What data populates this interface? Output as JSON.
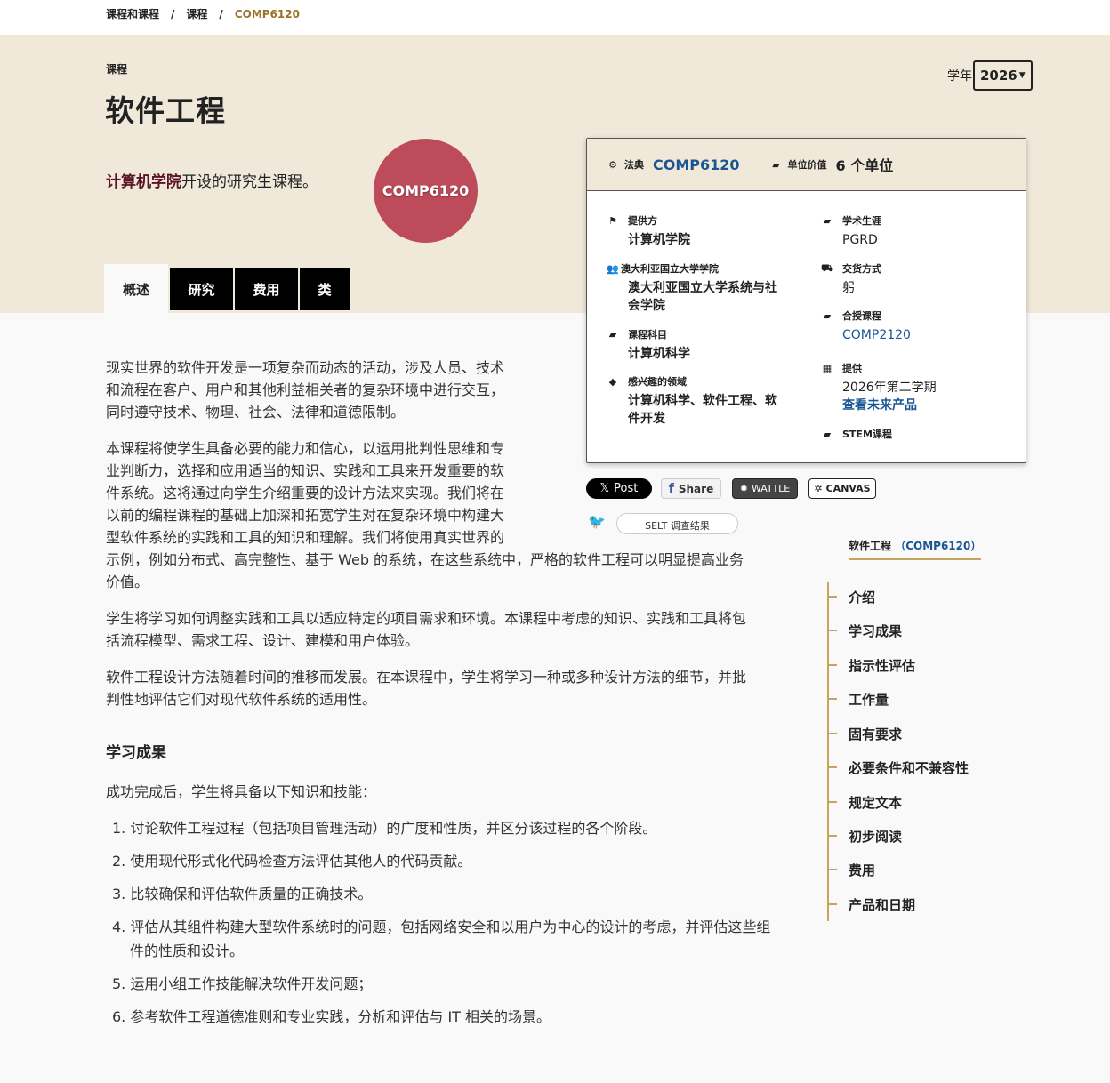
{
  "breadcrumb": [
    "课程和课程",
    "课程",
    "COMP6120"
  ],
  "hero": {
    "eyebrow": "课程",
    "title": "软件工程",
    "intro_school": "计算机学院",
    "intro_rest": "开设的研究生课程。",
    "badge": "COMP6120"
  },
  "year": {
    "label": "学年",
    "value": "2026"
  },
  "tabs": [
    "概述",
    "研究",
    "费用",
    "类"
  ],
  "infobox": {
    "code_label": "法典",
    "code_value": "COMP6120",
    "unit_label": "单位价值",
    "unit_value": "6 个单位",
    "fields": {
      "offered_by_label": "提供方",
      "offered_by_value": "计算机学院",
      "career_label": "学术生涯",
      "career_value": "PGRD",
      "college_label": "澳大利亚国立大学学院",
      "college_value_1": "澳大利亚国立大学系统与社",
      "college_value_2": "会学院",
      "delivery_label": "交货方式",
      "delivery_value": "躬",
      "co_taught_label": "合授课程",
      "co_taught_value": "COMP2120",
      "subject_label": "课程科目",
      "subject_value": "计算机科学",
      "offering_label": "提供",
      "offering_value": "2026年第二学期",
      "offering_link": "查看未来产品",
      "interest_label": "感兴趣的领域",
      "interest_value_1": "计算机科学、软件工程、软",
      "interest_value_2": "件开发",
      "stem_label": "STEM课程"
    }
  },
  "social": {
    "post": "Post",
    "share": "Share",
    "wattle": "WATTLE",
    "canvas": "CANVAS",
    "selt": "SELT 调查结果"
  },
  "body": {
    "p1": [
      "现实世界的软件开发是一项复杂而动态的活动，涉及人员、技术",
      "和流程在客户、用户和其他利益相关者的复杂环境中进行交互，",
      "同时遵守技术、物理、社会、法律和道德限制。"
    ],
    "p2": [
      "本课程将使学生具备必要的能力和信心，以运用批判性思维和专",
      "业判断力，选择和应用适当的知识、实践和工具来开发重要的软",
      "件系统。这将通过向学生介绍重要的设计方法来实现。我们将在",
      "以前的编程课程的基础上加深和拓宽学生对在复杂环境中构建大",
      "型软件系统的实践和工具的知识和理解。我们将使用真实世界的",
      "示例，例如分布式、高完整性、基于 Web 的系统，在这些系统中，严格的软件工程可以明显提高业务",
      "价值。"
    ],
    "p3": [
      "学生将学习如何调整实践和工具以适应特定的项目需求和环境。本课程中考虑的知识、实践和工具将包",
      "括流程模型、需求工程、设计、建模和用户体验。"
    ],
    "p4": [
      "软件工程设计方法随着时间的推移而发展。在本课程中，学生将学习一种或多种设计方法的细节，并批",
      "判性地评估它们对现代软件系统的适用性。"
    ],
    "outcomes_heading": "学习成果",
    "outcomes_intro": "成功完成后，学生将具备以下知识和技能：",
    "outcomes": [
      "1. 讨论软件工程过程（包括项目管理活动）的广度和性质，并区分该过程的各个阶段。",
      "2. 使用现代形式化代码检查方法评估其他人的代码贡献。",
      "3. 比较确保和评估软件质量的正确技术。",
      "4. 评估从其组件构建大型软件系统时的问题，包括网络安全和以用户为中心的设计的考虑，并评估这些组件的性质和设计。",
      "5. 运用小组工作技能解决软件开发问题；",
      "6. 参考软件工程道德准则和专业实践，分析和评估与 IT 相关的场景。"
    ]
  },
  "toc": {
    "title_text": "软件工程",
    "title_code": "（COMP6120）",
    "items": [
      "介绍",
      "学习成果",
      "指示性评估",
      "工作量",
      "固有要求",
      "必要条件和不兼容性",
      "规定文本",
      "初步阅读",
      "费用",
      "产品和日期"
    ]
  }
}
